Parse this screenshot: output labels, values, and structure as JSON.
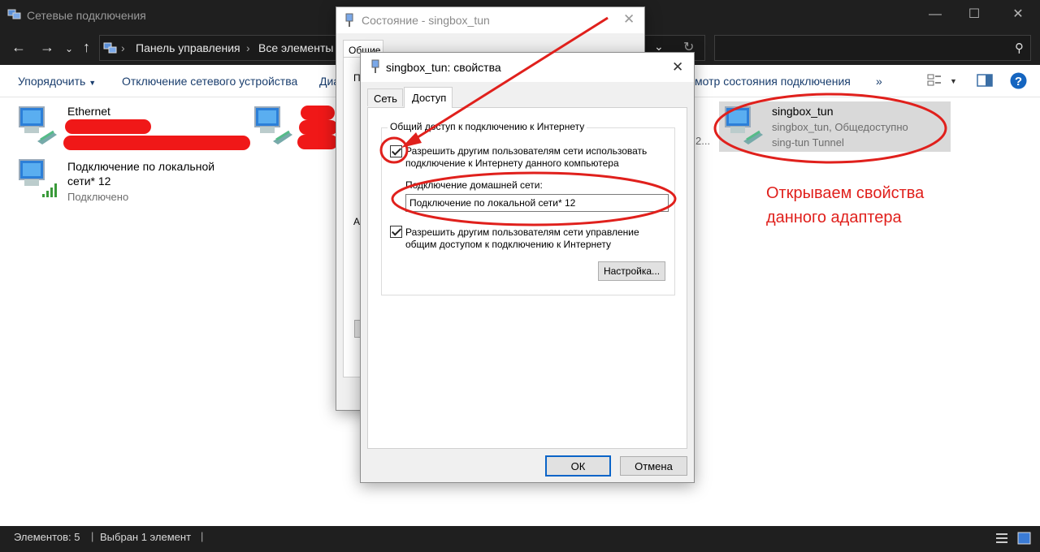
{
  "window": {
    "title": "Сетевые подключения"
  },
  "address": {
    "path": [
      "Панель управления",
      "Все элементы п"
    ],
    "separator": "›"
  },
  "toolbar": {
    "organize": "Упорядочить",
    "disable_device": "Отключение сетевого устройства",
    "diagnose_partial": "Диа",
    "view_status": "смотр состояния подключения",
    "more": "»"
  },
  "connections": [
    {
      "name": "Ethernet"
    },
    {
      "name_line1": "Подключение по локальной",
      "name_line2": "сети* 12",
      "status": "Подключено"
    },
    {
      "name": "singbox_tun",
      "status": "singbox_tun, Общедоступно",
      "device": "sing-tun Tunnel"
    }
  ],
  "partial_text": "2...",
  "status_dialog": {
    "title": "Состояние - singbox_tun",
    "tab_general": "Общие",
    "stub_p": "П",
    "stub_a": "А"
  },
  "props_dialog": {
    "title": "singbox_tun: свойства",
    "tabs": [
      "Сеть",
      "Доступ"
    ],
    "group_title": "Общий доступ к подключению к Интернету",
    "allow_sharing_line1": "Разрешить другим пользователям сети использовать",
    "allow_sharing_line2": "подключение к Интернету данного компьютера",
    "home_network_label": "Подключение домашней сети:",
    "home_network_value": "Подключение по локальной сети* 12",
    "allow_control_line1": "Разрешить другим пользователям сети управление",
    "allow_control_line2": "общим доступом к подключению к Интернету",
    "settings_button": "Настройка...",
    "ok_button": "ОК",
    "cancel_button": "Отмена"
  },
  "annotation": {
    "line1": "Открываем свойства",
    "line2": "данного адаптера"
  },
  "statusbar": {
    "items_count": "Элементов: 5",
    "selected": "Выбран 1 элемент"
  },
  "colors": {
    "annotation_red": "#e0201c",
    "dark_chrome": "#1f1f1f",
    "link_blue": "#1a3e6e",
    "selection": "#d9d9d9"
  }
}
